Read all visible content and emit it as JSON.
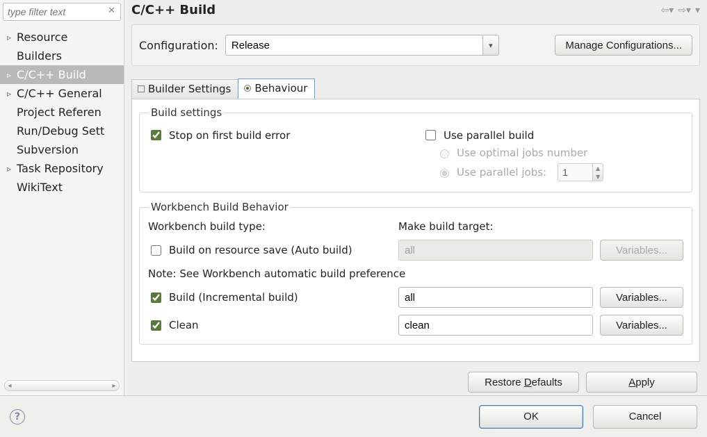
{
  "filter": {
    "placeholder": "type filter text"
  },
  "tree": [
    {
      "label": "Resource",
      "expander": "▹",
      "selected": false
    },
    {
      "label": "Builders",
      "expander": "",
      "selected": false
    },
    {
      "label": "C/C++ Build",
      "expander": "▹",
      "selected": true
    },
    {
      "label": "C/C++ General",
      "expander": "▹",
      "selected": false
    },
    {
      "label": "Project Referen",
      "expander": "",
      "selected": false
    },
    {
      "label": "Run/Debug Sett",
      "expander": "",
      "selected": false
    },
    {
      "label": "Subversion",
      "expander": "",
      "selected": false
    },
    {
      "label": "Task Repository",
      "expander": "▹",
      "selected": false
    },
    {
      "label": "WikiText",
      "expander": "",
      "selected": false
    }
  ],
  "page": {
    "title": "C/C++ Build",
    "configuration_label": "Configuration:",
    "configuration_value": "Release",
    "manage_configurations": "Manage Configurations...",
    "tabs": {
      "builder_settings": "Builder Settings",
      "behaviour": "Behaviour",
      "active": "behaviour"
    },
    "build_settings": {
      "legend": "Build settings",
      "stop_on_first_error": {
        "label": "Stop on first build error",
        "checked": true
      },
      "use_parallel_build": {
        "label": "Use parallel build",
        "checked": false
      },
      "use_optimal_jobs": {
        "label": "Use optimal jobs number",
        "selected": false,
        "enabled": false
      },
      "use_parallel_jobs": {
        "label": "Use parallel jobs:",
        "selected": true,
        "enabled": false,
        "value": "1"
      }
    },
    "workbench": {
      "legend": "Workbench Build Behavior",
      "col_type": "Workbench build type:",
      "col_target": "Make build target:",
      "auto_build": {
        "label": "Build on resource save (Auto build)",
        "checked": false,
        "target": "all",
        "target_enabled": false,
        "variables_enabled": false
      },
      "note": "Note: See Workbench automatic build preference",
      "incremental": {
        "label": "Build (Incremental build)",
        "checked": true,
        "target": "all",
        "target_enabled": true,
        "variables_enabled": true
      },
      "clean": {
        "label": "Clean",
        "checked": true,
        "target": "clean",
        "target_enabled": true,
        "variables_enabled": true
      },
      "variables_button": "Variables..."
    },
    "restore_defaults": "Restore Defaults",
    "apply": "Apply"
  },
  "dialog": {
    "ok": "OK",
    "cancel": "Cancel"
  }
}
